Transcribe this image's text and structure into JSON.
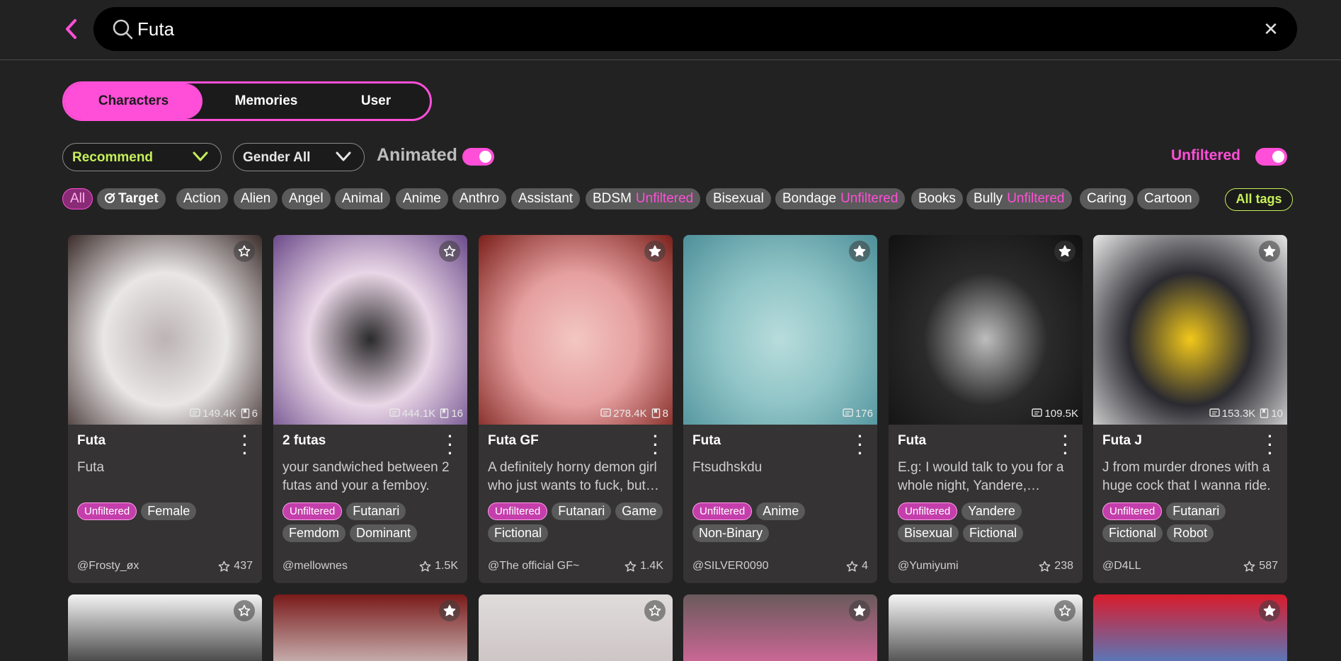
{
  "search": {
    "value": "Futa",
    "placeholder": "Search"
  },
  "tabs": [
    {
      "label": "Characters",
      "active": true
    },
    {
      "label": "Memories",
      "active": false
    },
    {
      "label": "User",
      "active": false
    }
  ],
  "filters": {
    "sort": "Recommend",
    "gender": "Gender All",
    "animated_label": "Animated",
    "animated_on": true,
    "unfiltered_label": "Unfiltered",
    "unfiltered_on": true
  },
  "tags": [
    {
      "label": "All",
      "unfiltered": false
    },
    {
      "label": "Target",
      "unfiltered": false
    },
    {
      "label": "Action",
      "unfiltered": false
    },
    {
      "label": "Alien",
      "unfiltered": false
    },
    {
      "label": "Angel",
      "unfiltered": false
    },
    {
      "label": "Animal",
      "unfiltered": false
    },
    {
      "label": "Anime",
      "unfiltered": false
    },
    {
      "label": "Anthro",
      "unfiltered": false
    },
    {
      "label": "Assistant",
      "unfiltered": false
    },
    {
      "label": "BDSM",
      "unfiltered": true
    },
    {
      "label": "Bisexual",
      "unfiltered": false
    },
    {
      "label": "Bondage",
      "unfiltered": true
    },
    {
      "label": "Books",
      "unfiltered": false
    },
    {
      "label": "Bully",
      "unfiltered": true
    },
    {
      "label": "Caring",
      "unfiltered": false
    },
    {
      "label": "Cartoon",
      "unfiltered": false
    }
  ],
  "unfiltered_badge": "Unfiltered",
  "all_tags_label": "All tags",
  "cards": [
    {
      "name": "Futa",
      "desc": "Futa",
      "chats": "149.4K",
      "memories": "6",
      "tags": [
        "Unfiltered",
        "Female"
      ],
      "author": "@Frosty_øx",
      "likes": "437",
      "fav_filled": false,
      "palette": [
        "#e9e6e6",
        "#3a2c2a",
        "#bdb4b4"
      ]
    },
    {
      "name": "2 futas",
      "desc": "your sandwiched between 2 futas and your a femboy.",
      "chats": "444.1K",
      "memories": "16",
      "tags": [
        "Unfiltered",
        "Futanari",
        "Femdom",
        "Dominant"
      ],
      "author": "@mellownes",
      "likes": "1.5K",
      "fav_filled": false,
      "palette": [
        "#e9d6e6",
        "#6b4a8a",
        "#2a2a2a"
      ]
    },
    {
      "name": "Futa GF",
      "desc": "A definitely horny demon girl who just wants to fuck, but she's lonely too.",
      "chats": "278.4K",
      "memories": "8",
      "tags": [
        "Unfiltered",
        "Futanari",
        "Game",
        "Fictional"
      ],
      "author": "@The official GF~",
      "likes": "1.4K",
      "fav_filled": true,
      "palette": [
        "#e59f9f",
        "#7a1f1a",
        "#f3c7c2"
      ]
    },
    {
      "name": "Futa",
      "desc": "Ftsudhskdu",
      "chats": "176",
      "memories": "",
      "tags": [
        "Unfiltered",
        "Anime",
        "Non-Binary"
      ],
      "author": "@SILVER0090",
      "likes": "4",
      "fav_filled": true,
      "palette": [
        "#8fc4c6",
        "#4d8f99",
        "#b8dcdc"
      ]
    },
    {
      "name": "Futa",
      "desc": "E.g: I would talk to you for a whole night, Yandere, obsessive and loving.",
      "chats": "109.5K",
      "memories": "",
      "tags": [
        "Unfiltered",
        "Yandere",
        "Bisexual",
        "Fictional"
      ],
      "author": "@Yumiyumi",
      "likes": "238",
      "fav_filled": true,
      "palette": [
        "#2b2b2b",
        "#111111",
        "#bdbdbd"
      ]
    },
    {
      "name": "Futa J",
      "desc": "J from murder drones with a huge cock that I wanna ride.",
      "chats": "153.3K",
      "memories": "10",
      "tags": [
        "Unfiltered",
        "Futanari",
        "Fictional",
        "Robot"
      ],
      "author": "@D4LL",
      "likes": "587",
      "fav_filled": true,
      "palette": [
        "#2a2a30",
        "#e8e8e8",
        "#f2c81a"
      ]
    }
  ],
  "row2": [
    {
      "fav_filled": false,
      "palette": [
        "#f4f4f4",
        "#1d1d1d"
      ]
    },
    {
      "fav_filled": true,
      "palette": [
        "#7a1a1a",
        "#d9d2d2"
      ]
    },
    {
      "fav_filled": false,
      "palette": [
        "#e0dcdc",
        "#c9bfbf"
      ]
    },
    {
      "fav_filled": true,
      "palette": [
        "#6a5a5c",
        "#e46aa3"
      ]
    },
    {
      "fav_filled": false,
      "palette": [
        "#f6f6f6",
        "#2a2a2a"
      ]
    },
    {
      "fav_filled": true,
      "palette": [
        "#d81c2c",
        "#3a8edc"
      ]
    }
  ],
  "colors": {
    "accent": "#ff4fd8",
    "lime": "#c6f05a",
    "bg": "#232222",
    "card": "#353333"
  }
}
